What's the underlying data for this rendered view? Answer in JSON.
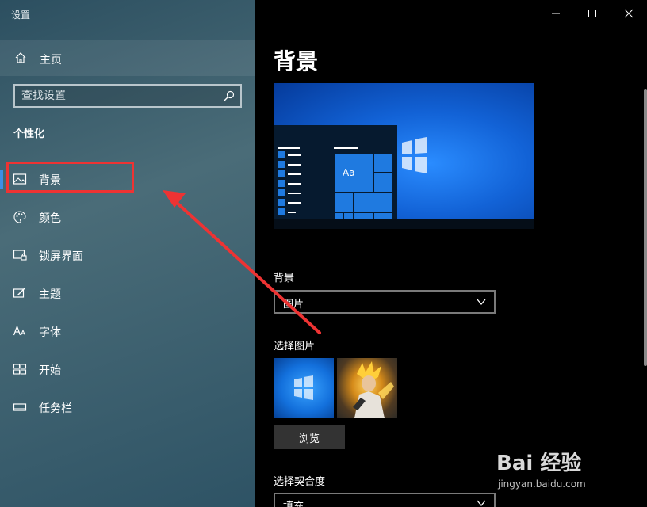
{
  "app": {
    "title": "设置"
  },
  "sidebar": {
    "home_label": "主页",
    "search_placeholder": "查找设置",
    "section_title": "个性化",
    "items": [
      {
        "label": "背景",
        "icon": "picture-icon",
        "active": true
      },
      {
        "label": "颜色",
        "icon": "palette-icon"
      },
      {
        "label": "锁屏界面",
        "icon": "lock-screen-icon"
      },
      {
        "label": "主题",
        "icon": "theme-icon"
      },
      {
        "label": "字体",
        "icon": "font-icon"
      },
      {
        "label": "开始",
        "icon": "start-icon"
      },
      {
        "label": "任务栏",
        "icon": "taskbar-icon"
      }
    ]
  },
  "main": {
    "page_title": "背景",
    "preview_sample_text": "Aa",
    "background_label": "背景",
    "background_value": "图片",
    "choose_picture_label": "选择图片",
    "browse_label": "浏览",
    "fit_label": "选择契合度",
    "fit_value": "填充"
  },
  "watermark": {
    "main": "Bai 经验",
    "sub": "jingyan.baidu.com"
  },
  "colors": {
    "accent": "#3d8ee6",
    "highlight": "#ee3333"
  }
}
